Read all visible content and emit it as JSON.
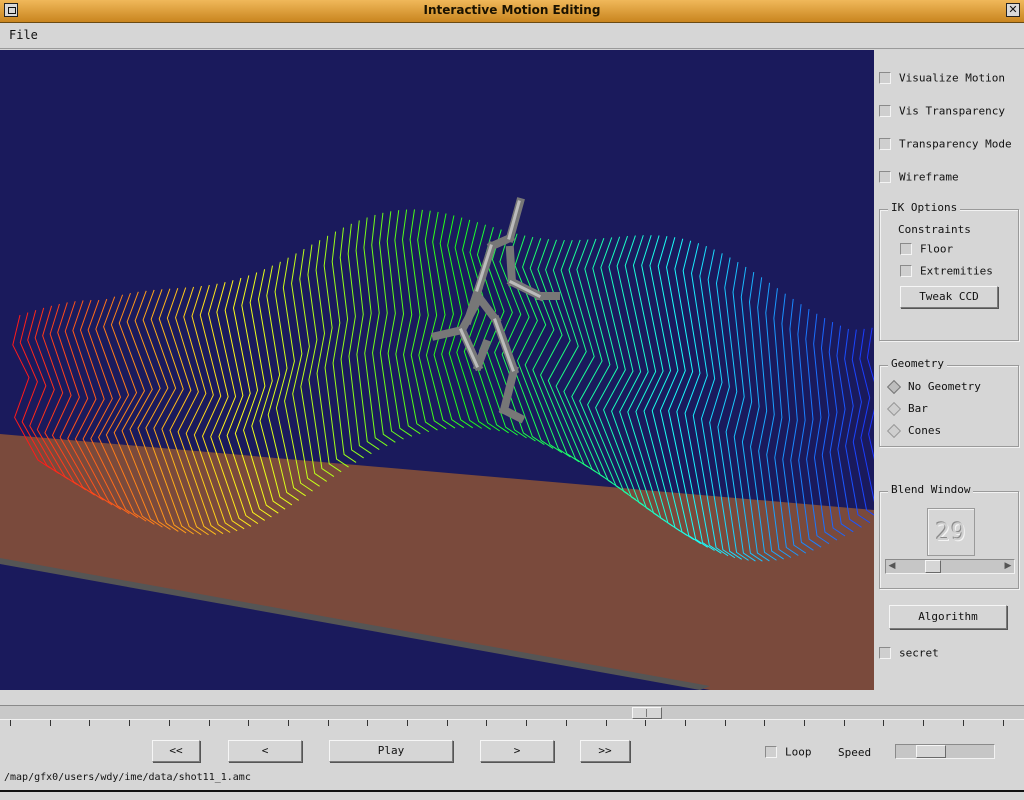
{
  "window": {
    "title": "Interactive Motion Editing",
    "close_glyph": "✕"
  },
  "menu": {
    "file": "File"
  },
  "panel": {
    "visualize_motion": "Visualize Motion",
    "vis_transparency": "Vis Transparency",
    "transparency_mode": "Transparency Mode",
    "wireframe": "Wireframe",
    "ik_options": {
      "title": "IK Options",
      "constraints": "Constraints",
      "floor": "Floor",
      "extremities": "Extremities",
      "tweak_ccd": "Tweak CCD"
    },
    "geometry": {
      "title": "Geometry",
      "options": [
        "No Geometry",
        "Bar",
        "Cones"
      ],
      "selected": "No Geometry"
    },
    "blend_window": {
      "title": "Blend Window",
      "value": "29",
      "slider_level": 0.3
    },
    "algorithm": "Algorithm",
    "secret": "secret"
  },
  "transport": {
    "rewind": "<<",
    "step_back": "<",
    "play": "Play",
    "step_forward": ">",
    "fast_forward": ">>",
    "loop": "Loop",
    "speed": "Speed",
    "speed_level": 0.25
  },
  "timeline": {
    "position": 0.63
  },
  "status": {
    "path": "/map/gfx0/users/wdy/ime/data/shot11_1.amc"
  },
  "colors": {
    "sky": "#1a1a5c",
    "floor": "#7a4a3c",
    "title_bar": "#e0a040",
    "panel": "#d6d6d6"
  }
}
